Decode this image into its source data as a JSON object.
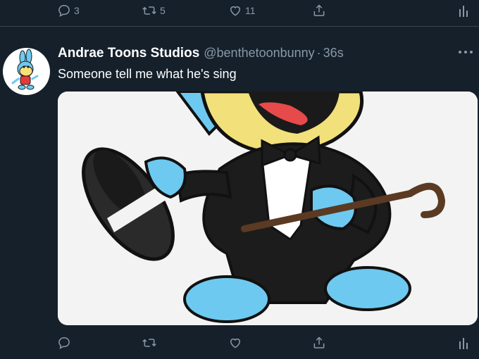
{
  "prev_tweet": {
    "reply_count": "3",
    "retweet_count": "5",
    "like_count": "11"
  },
  "tweet": {
    "display_name": "Andrae Toons Studios",
    "handle": "@benthetoonbunny",
    "separator": "·",
    "timestamp": "36s",
    "text": "Someone tell me what he's sing",
    "media_description": "cartoon character in a tuxedo tipping a top hat and holding a cane"
  },
  "icons": {
    "reply": "reply-icon",
    "retweet": "retweet-icon",
    "like": "heart-icon",
    "share": "share-icon",
    "analytics": "analytics-icon",
    "more": "more-icon"
  },
  "colors": {
    "background": "#15202b",
    "muted": "#8899a6",
    "divider": "#38444d",
    "text": "#ffffff"
  }
}
